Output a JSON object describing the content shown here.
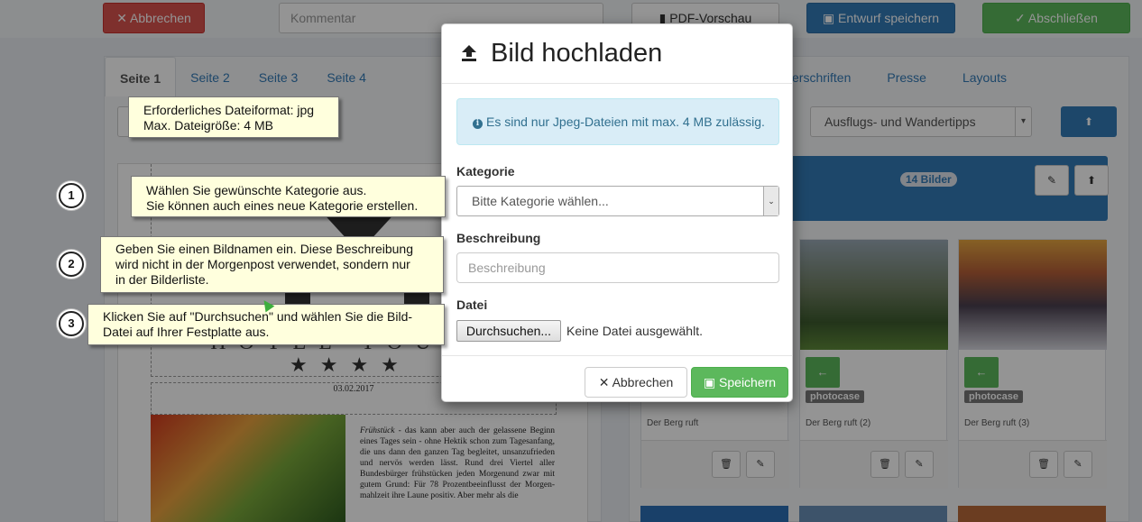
{
  "topbar": {
    "cancel_label": "✕ Abbrechen",
    "comment_placeholder": "Kommentar",
    "pdf_label": "PDF-Vorschau",
    "draft_label": "Entwurf speichern",
    "finish_label": "✓ Abschließen"
  },
  "page_tabs": [
    "Seite 1",
    "Seite 2",
    "Seite 3",
    "Seite 4"
  ],
  "right_tabs": [
    "erschriften",
    "Presse",
    "Layouts"
  ],
  "category_filter": "Ausflugs- und Wandertipps",
  "album": {
    "count_badge": "14 Bilder"
  },
  "paper": {
    "hotel_text": "HOTEL TOURS",
    "date": "03.02.2017",
    "article_lead": "Frühstück",
    "article_text": " - das kann aber auch der gelassene Beginn eines Tages sein - ohne Hektik schon zum Tagesanfang, die uns dann den ganzen Tag begleitet, unsanzufrieden und nervös werden lässt. Rund drei Viertel aller Bundesbürger frühstücken jeden Morgenund zwar mit gutem Grund: Für 78 Prozentbeeinflusst der Morgen-mahlzeit ihre Laune positiv. Aber mehr als die"
  },
  "thumbs": [
    {
      "credit": "photocase",
      "name": "Der Berg ruft"
    },
    {
      "credit": "photocase",
      "name": "Der Berg ruft (2)"
    },
    {
      "credit": "photocase",
      "name": "Der Berg ruft (3)"
    }
  ],
  "modal": {
    "title": "Bild hochladen",
    "alert": "Es sind nur Jpeg-Dateien mit max. 4 MB zulässig.",
    "category_label": "Kategorie",
    "category_value": "Bitte Kategorie wählen...",
    "description_label": "Beschreibung",
    "description_placeholder": "Beschreibung",
    "file_label": "Datei",
    "browse_label": "Durchsuchen...",
    "file_status": "Keine Datei ausgewählt.",
    "cancel_label": "Abbrechen",
    "save_label": "Speichern"
  },
  "tooltips": {
    "format": "Erforderliches Dateiformat: jpg\nMax. Dateigröße: 4 MB",
    "step1": "Wählen Sie gewünschte Kategorie aus.\nSie können auch eines neue Kategorie erstellen.",
    "step2": "Geben Sie einen Bildnamen ein. Diese Beschreibung\nwird nicht in der Morgenpost verwendet, sondern nur\nin der Bilderliste.",
    "step3": "Klicken Sie auf \"Durchsuchen\" und wählen Sie die Bild-\nDatei auf Ihrer Festplatte aus."
  },
  "step_numbers": [
    "1",
    "2",
    "3"
  ],
  "colors": {
    "primary": "#337ab7",
    "success": "#5cb85c",
    "danger": "#d9534f",
    "info_bg": "#d9edf7",
    "tooltip_bg": "#ffffdd"
  }
}
